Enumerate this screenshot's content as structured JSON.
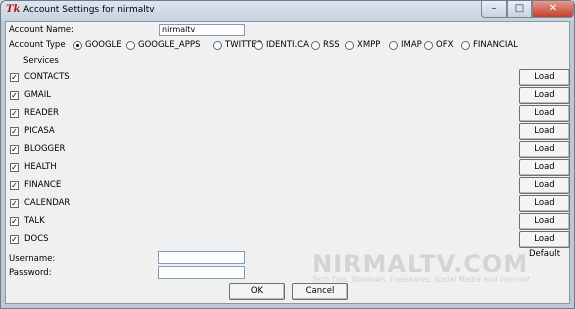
{
  "window": {
    "title": "Account Settings for nirmaltv",
    "app_icon": "Tk"
  },
  "controls": {
    "minimize": "–",
    "maximize": "□",
    "close": "✕"
  },
  "form": {
    "account_name_label": "Account Name:",
    "account_name_value": "nirmaltv",
    "account_type_label": "Account Type",
    "account_types": [
      "GOOGLE",
      "GOOGLE_APPS",
      "TWITTER",
      "IDENTI.CA",
      "RSS",
      "XMPP",
      "IMAP",
      "OFX",
      "FINANCIAL"
    ],
    "selected_type": "GOOGLE",
    "services_label": "Services",
    "services": [
      {
        "name": "CONTACTS",
        "checked": true
      },
      {
        "name": "GMAIL",
        "checked": true
      },
      {
        "name": "READER",
        "checked": true
      },
      {
        "name": "PICASA",
        "checked": true
      },
      {
        "name": "BLOGGER",
        "checked": true
      },
      {
        "name": "HEALTH",
        "checked": true
      },
      {
        "name": "FINANCE",
        "checked": true
      },
      {
        "name": "CALENDAR",
        "checked": true
      },
      {
        "name": "TALK",
        "checked": true
      },
      {
        "name": "DOCS",
        "checked": true
      }
    ],
    "load_default_label": "Load Default",
    "username_label": "Username:",
    "username_value": "",
    "password_label": "Password:",
    "password_value": ""
  },
  "buttons": {
    "ok": "OK",
    "cancel": "Cancel"
  },
  "watermark": {
    "brand": "NIRMALTV.COM",
    "tagline": "Tech Tips, Windows, Freewares, Social Media and Internet"
  }
}
